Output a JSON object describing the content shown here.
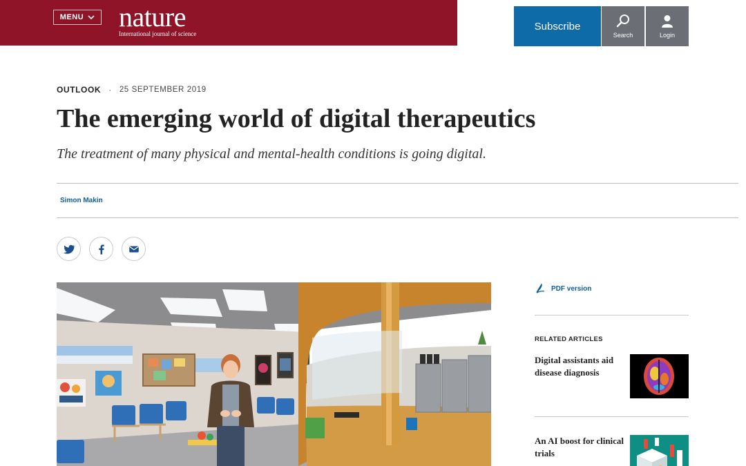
{
  "header": {
    "menu_label": "MENU",
    "logo_word": "nature",
    "logo_tagline": "International journal of science",
    "subscribe_label": "Subscribe",
    "search_label": "Search",
    "login_label": "Login",
    "brand_color": "#8f1428",
    "accent_color": "#0f6aa8"
  },
  "article": {
    "section": "OUTLOOK",
    "separator": "·",
    "date": "25 SEPTEMBER 2019",
    "title": "The emerging world of digital therapeutics",
    "standfirst": "The treatment of many physical and mental-health conditions is going digital.",
    "author": "Simon Makin"
  },
  "share": {
    "icons": [
      "twitter-icon",
      "facebook-icon",
      "email-icon"
    ]
  },
  "sidebar": {
    "pdf_label": "PDF version",
    "related_heading": "RELATED ARTICLES",
    "related": [
      {
        "title": "Digital assistants aid disease diagnosis"
      },
      {
        "title": "An AI boost for clinical trials"
      }
    ]
  }
}
